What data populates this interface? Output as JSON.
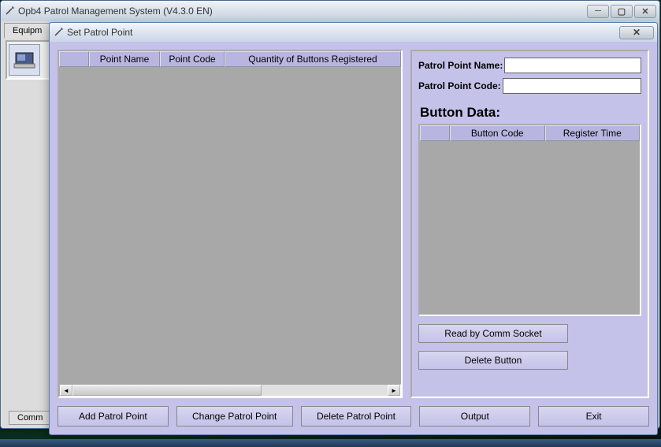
{
  "parent_window": {
    "title": "Opb4  Patrol Management System (V4.3.0 EN)",
    "tab": "Equipm",
    "bottom_tab": "Comm"
  },
  "dialog": {
    "title": "Set Patrol Point",
    "left_grid": {
      "columns": [
        "Point Name",
        "Point Code",
        "Quantity of Buttons Registered"
      ]
    },
    "form": {
      "name_label": "Patrol Point Name:",
      "code_label": "Patrol Point Code:",
      "name_value": "",
      "code_value": ""
    },
    "button_data_heading": "Button Data:",
    "small_grid": {
      "columns": [
        "Button Code",
        "Register Time"
      ]
    },
    "buttons": {
      "read_comm": "Read by Comm Socket",
      "delete_btn": "Delete Button",
      "add_point": "Add Patrol Point",
      "change_point": "Change Patrol Point",
      "delete_point": "Delete Patrol Point",
      "output": "Output",
      "exit": "Exit"
    }
  }
}
